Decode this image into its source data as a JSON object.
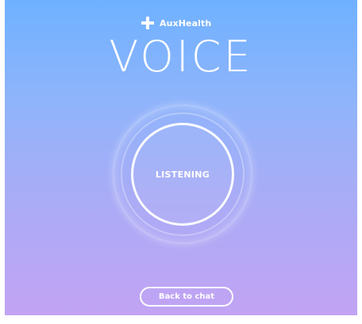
{
  "brand": {
    "name": "AuxHealth",
    "logo_icon": "medical-cross-icon"
  },
  "title": "VOICE",
  "status": {
    "label": "LISTENING"
  },
  "actions": {
    "back_label": "Back to chat"
  },
  "colors": {
    "gradient_top": "#6fb1ff",
    "gradient_bottom": "#c2a3f4",
    "foreground": "#ffffff"
  }
}
